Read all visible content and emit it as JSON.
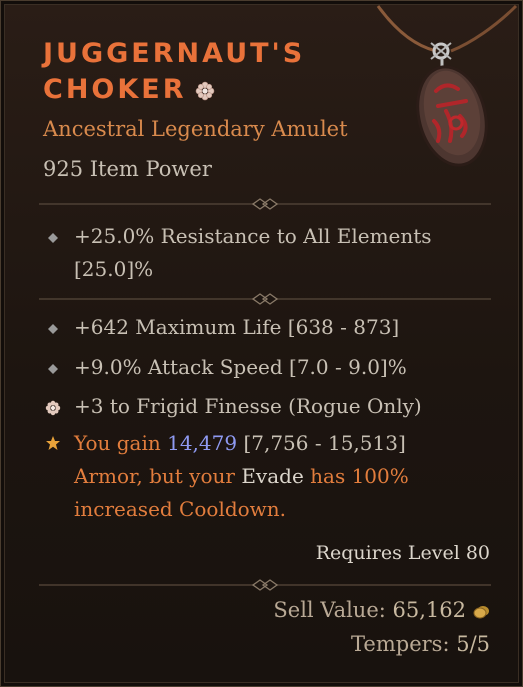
{
  "item": {
    "name": "JUGGERNAUT'S CHOKER",
    "type": "Ancestral Legendary Amulet",
    "item_power": "925 Item Power"
  },
  "affixes": [
    {
      "text": "+25.0% Resistance to All Elements [25.0]%",
      "icon": "diamond-bullet-icon"
    }
  ],
  "stats": [
    {
      "text": "+642 Maximum Life [638 - 873]",
      "icon": "diamond-bullet-icon"
    },
    {
      "text": "+9.0% Attack Speed [7.0 - 9.0]%",
      "icon": "diamond-bullet-icon"
    },
    {
      "text": "+3 to Frigid Finesse (Rogue Only)",
      "icon": "flower-bullet-icon"
    }
  ],
  "legendary_power": {
    "part1": "You gain ",
    "value": "14,479",
    "range": " [7,756 - 15,513]",
    "part2": "Armor, but your ",
    "skill": "Evade",
    "part3": " has 100%",
    "part4": "increased Cooldown.",
    "icon": "star-bullet-icon"
  },
  "requirements": "Requires Level 80",
  "sell": {
    "label": "Sell Value: ",
    "value": "65,162"
  },
  "tempers": {
    "label": "Tempers: ",
    "value": "5/5"
  },
  "colors": {
    "title": "#e9723a",
    "legendary": "#d98a4d",
    "value_blue": "#8f9af2",
    "text": "#c8c0b4"
  }
}
